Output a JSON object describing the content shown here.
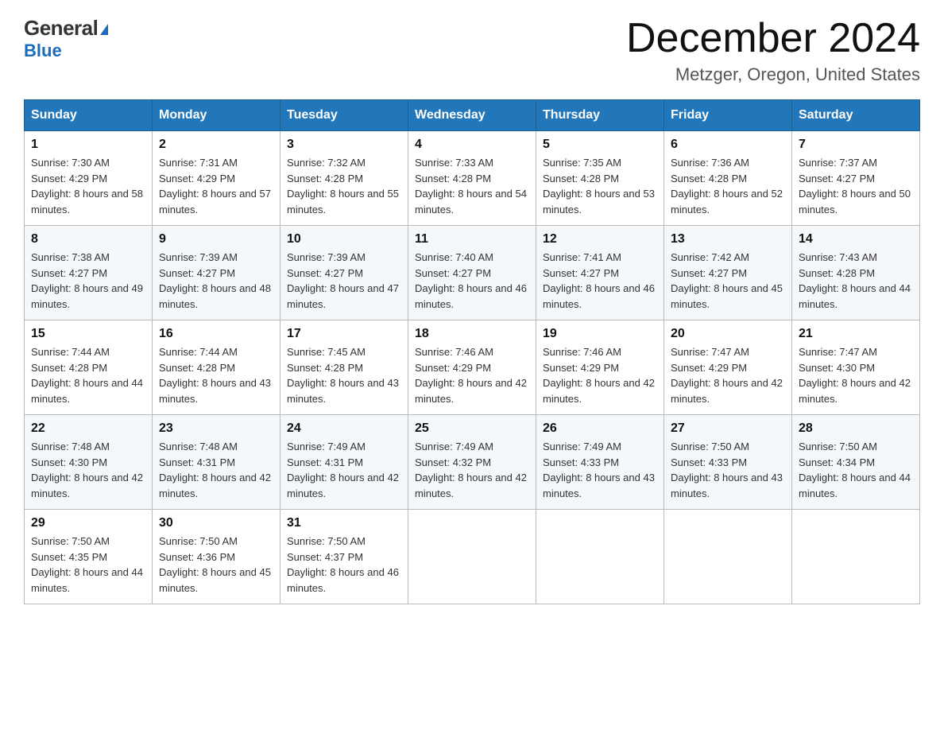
{
  "header": {
    "logo_general": "General",
    "logo_blue": "Blue",
    "month_title": "December 2024",
    "location": "Metzger, Oregon, United States"
  },
  "weekdays": [
    "Sunday",
    "Monday",
    "Tuesday",
    "Wednesday",
    "Thursday",
    "Friday",
    "Saturday"
  ],
  "weeks": [
    [
      {
        "day": 1,
        "sunrise": "7:30 AM",
        "sunset": "4:29 PM",
        "daylight": "8 hours and 58 minutes."
      },
      {
        "day": 2,
        "sunrise": "7:31 AM",
        "sunset": "4:29 PM",
        "daylight": "8 hours and 57 minutes."
      },
      {
        "day": 3,
        "sunrise": "7:32 AM",
        "sunset": "4:28 PM",
        "daylight": "8 hours and 55 minutes."
      },
      {
        "day": 4,
        "sunrise": "7:33 AM",
        "sunset": "4:28 PM",
        "daylight": "8 hours and 54 minutes."
      },
      {
        "day": 5,
        "sunrise": "7:35 AM",
        "sunset": "4:28 PM",
        "daylight": "8 hours and 53 minutes."
      },
      {
        "day": 6,
        "sunrise": "7:36 AM",
        "sunset": "4:28 PM",
        "daylight": "8 hours and 52 minutes."
      },
      {
        "day": 7,
        "sunrise": "7:37 AM",
        "sunset": "4:27 PM",
        "daylight": "8 hours and 50 minutes."
      }
    ],
    [
      {
        "day": 8,
        "sunrise": "7:38 AM",
        "sunset": "4:27 PM",
        "daylight": "8 hours and 49 minutes."
      },
      {
        "day": 9,
        "sunrise": "7:39 AM",
        "sunset": "4:27 PM",
        "daylight": "8 hours and 48 minutes."
      },
      {
        "day": 10,
        "sunrise": "7:39 AM",
        "sunset": "4:27 PM",
        "daylight": "8 hours and 47 minutes."
      },
      {
        "day": 11,
        "sunrise": "7:40 AM",
        "sunset": "4:27 PM",
        "daylight": "8 hours and 46 minutes."
      },
      {
        "day": 12,
        "sunrise": "7:41 AM",
        "sunset": "4:27 PM",
        "daylight": "8 hours and 46 minutes."
      },
      {
        "day": 13,
        "sunrise": "7:42 AM",
        "sunset": "4:27 PM",
        "daylight": "8 hours and 45 minutes."
      },
      {
        "day": 14,
        "sunrise": "7:43 AM",
        "sunset": "4:28 PM",
        "daylight": "8 hours and 44 minutes."
      }
    ],
    [
      {
        "day": 15,
        "sunrise": "7:44 AM",
        "sunset": "4:28 PM",
        "daylight": "8 hours and 44 minutes."
      },
      {
        "day": 16,
        "sunrise": "7:44 AM",
        "sunset": "4:28 PM",
        "daylight": "8 hours and 43 minutes."
      },
      {
        "day": 17,
        "sunrise": "7:45 AM",
        "sunset": "4:28 PM",
        "daylight": "8 hours and 43 minutes."
      },
      {
        "day": 18,
        "sunrise": "7:46 AM",
        "sunset": "4:29 PM",
        "daylight": "8 hours and 42 minutes."
      },
      {
        "day": 19,
        "sunrise": "7:46 AM",
        "sunset": "4:29 PM",
        "daylight": "8 hours and 42 minutes."
      },
      {
        "day": 20,
        "sunrise": "7:47 AM",
        "sunset": "4:29 PM",
        "daylight": "8 hours and 42 minutes."
      },
      {
        "day": 21,
        "sunrise": "7:47 AM",
        "sunset": "4:30 PM",
        "daylight": "8 hours and 42 minutes."
      }
    ],
    [
      {
        "day": 22,
        "sunrise": "7:48 AM",
        "sunset": "4:30 PM",
        "daylight": "8 hours and 42 minutes."
      },
      {
        "day": 23,
        "sunrise": "7:48 AM",
        "sunset": "4:31 PM",
        "daylight": "8 hours and 42 minutes."
      },
      {
        "day": 24,
        "sunrise": "7:49 AM",
        "sunset": "4:31 PM",
        "daylight": "8 hours and 42 minutes."
      },
      {
        "day": 25,
        "sunrise": "7:49 AM",
        "sunset": "4:32 PM",
        "daylight": "8 hours and 42 minutes."
      },
      {
        "day": 26,
        "sunrise": "7:49 AM",
        "sunset": "4:33 PM",
        "daylight": "8 hours and 43 minutes."
      },
      {
        "day": 27,
        "sunrise": "7:50 AM",
        "sunset": "4:33 PM",
        "daylight": "8 hours and 43 minutes."
      },
      {
        "day": 28,
        "sunrise": "7:50 AM",
        "sunset": "4:34 PM",
        "daylight": "8 hours and 44 minutes."
      }
    ],
    [
      {
        "day": 29,
        "sunrise": "7:50 AM",
        "sunset": "4:35 PM",
        "daylight": "8 hours and 44 minutes."
      },
      {
        "day": 30,
        "sunrise": "7:50 AM",
        "sunset": "4:36 PM",
        "daylight": "8 hours and 45 minutes."
      },
      {
        "day": 31,
        "sunrise": "7:50 AM",
        "sunset": "4:37 PM",
        "daylight": "8 hours and 46 minutes."
      },
      null,
      null,
      null,
      null
    ]
  ]
}
